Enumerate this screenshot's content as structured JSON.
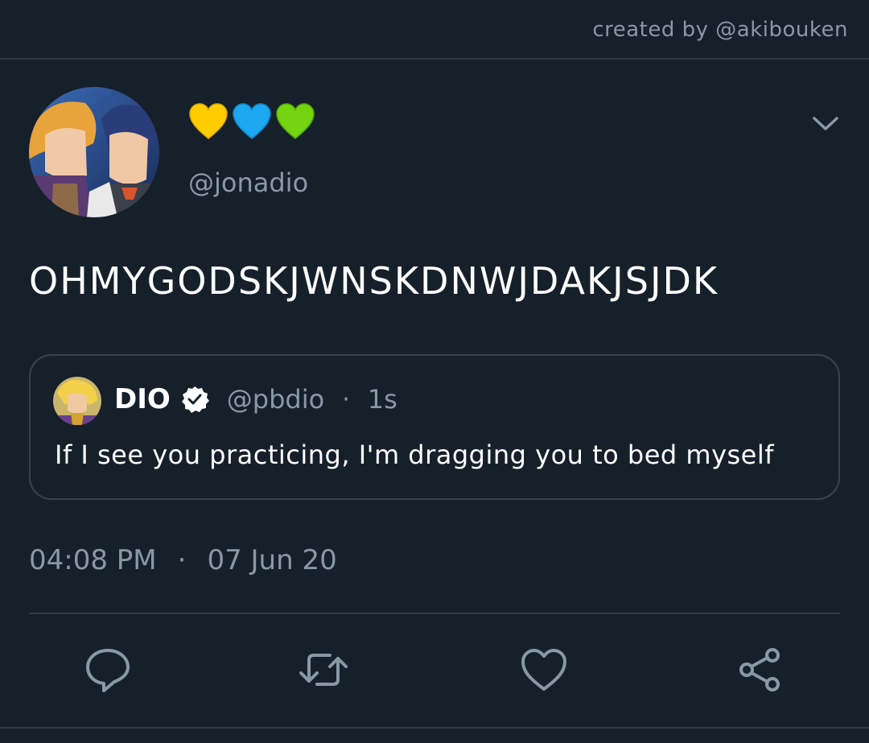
{
  "watermark": {
    "text": "created by @akibouken"
  },
  "author": {
    "display_name_emojis": [
      "💛",
      "💙",
      "💚"
    ],
    "handle": "@jonadio"
  },
  "tweet": {
    "text": "OHMYGODSKJWNSKDNWJDAKJSJDK"
  },
  "quoted_tweet": {
    "name": "DIO",
    "handle": "@pbdio",
    "separator": "·",
    "time": "1s",
    "text": "If I see you practicing, I'm dragging you to bed myself"
  },
  "meta": {
    "time": "04:08 PM",
    "separator": "·",
    "date": "07 Jun 20"
  },
  "actions": [
    {
      "icon": "reply-icon"
    },
    {
      "icon": "retweet-icon"
    },
    {
      "icon": "like-icon"
    },
    {
      "icon": "share-icon"
    }
  ],
  "colors": {
    "background": "#16202b",
    "secondary_text": "#8899a6",
    "border": "#38444d"
  }
}
